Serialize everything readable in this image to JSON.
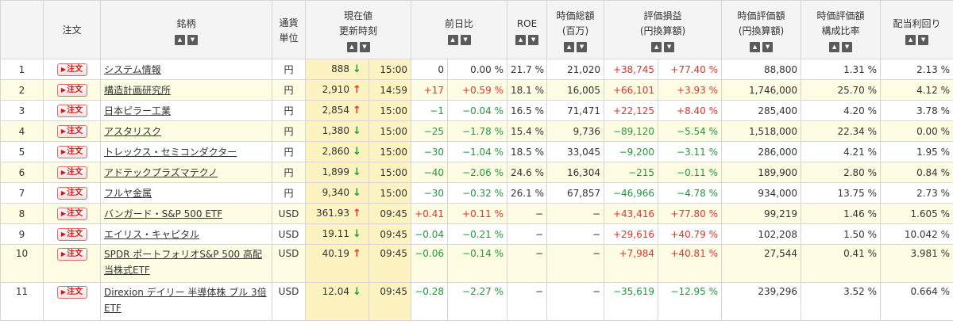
{
  "headers": {
    "no": "",
    "order": "注文",
    "name": "銘柄",
    "currency_line1": "通貨",
    "currency_line2": "単位",
    "price_line1": "現在値",
    "price_line2": "更新時刻",
    "change": "前日比",
    "roe": "ROE",
    "mcap_line1": "時価総額",
    "mcap_line2": "(百万)",
    "pl_line1": "評価損益",
    "pl_line2": "(円換算額)",
    "value_line1": "時価評価額",
    "value_line2": "(円換算額)",
    "weight_line1": "時価評価額",
    "weight_line2": "構成比率",
    "yield": "配当利回り"
  },
  "sort_icons": {
    "up": "sort-ascending-icon",
    "down": "sort-descending-icon",
    "up_glyph": "▲",
    "down_glyph": "▼"
  },
  "order_button": {
    "label": "注文",
    "icon": "triangle-right-icon",
    "color": "#d11111"
  },
  "colors": {
    "up": "#e8312f",
    "down": "#1e9b3a",
    "price_bg": "#fcf3c0",
    "alt_row": "#fffce4"
  },
  "rows": [
    {
      "no": "1",
      "name": "システム情報",
      "currency": "円",
      "price": "888",
      "dir": "down",
      "time": "15:00",
      "chg": "0",
      "chg_pct": "0.00 %",
      "chg_sign": "zero",
      "roe": "21.7 %",
      "mcap": "21,020",
      "pl": "+38,745",
      "pl_pct": "+77.40 %",
      "pl_sign": "pos",
      "value": "88,800",
      "weight": "1.31 %",
      "yield": "2.13 %"
    },
    {
      "no": "2",
      "name": "構造計画研究所",
      "currency": "円",
      "price": "2,910",
      "dir": "up",
      "time": "14:59",
      "chg": "+17",
      "chg_pct": "+0.59 %",
      "chg_sign": "pos",
      "roe": "18.1 %",
      "mcap": "16,005",
      "pl": "+66,101",
      "pl_pct": "+3.93 %",
      "pl_sign": "pos",
      "value": "1,746,000",
      "weight": "25.70 %",
      "yield": "4.12 %"
    },
    {
      "no": "3",
      "name": "日本ピラー工業",
      "currency": "円",
      "price": "2,854",
      "dir": "up",
      "time": "15:00",
      "chg": "−1",
      "chg_pct": "−0.04 %",
      "chg_sign": "neg",
      "roe": "16.5 %",
      "mcap": "71,471",
      "pl": "+22,125",
      "pl_pct": "+8.40 %",
      "pl_sign": "pos",
      "value": "285,400",
      "weight": "4.20 %",
      "yield": "3.78 %"
    },
    {
      "no": "4",
      "name": "アスタリスク",
      "currency": "円",
      "price": "1,380",
      "dir": "down",
      "time": "15:00",
      "chg": "−25",
      "chg_pct": "−1.78 %",
      "chg_sign": "neg",
      "roe": "15.4 %",
      "mcap": "9,736",
      "pl": "−89,120",
      "pl_pct": "−5.54 %",
      "pl_sign": "neg",
      "value": "1,518,000",
      "weight": "22.34 %",
      "yield": "0.00 %"
    },
    {
      "no": "5",
      "name": "トレックス・セミコンダクター",
      "currency": "円",
      "price": "2,860",
      "dir": "down",
      "time": "15:00",
      "chg": "−30",
      "chg_pct": "−1.04 %",
      "chg_sign": "neg",
      "roe": "18.5 %",
      "mcap": "33,045",
      "pl": "−9,200",
      "pl_pct": "−3.11 %",
      "pl_sign": "neg",
      "value": "286,000",
      "weight": "4.21 %",
      "yield": "1.95 %"
    },
    {
      "no": "6",
      "name": "アドテックプラズマテクノ",
      "currency": "円",
      "price": "1,899",
      "dir": "down",
      "time": "15:00",
      "chg": "−40",
      "chg_pct": "−2.06 %",
      "chg_sign": "neg",
      "roe": "24.6 %",
      "mcap": "16,304",
      "pl": "−215",
      "pl_pct": "−0.11 %",
      "pl_sign": "neg",
      "value": "189,900",
      "weight": "2.80 %",
      "yield": "0.84 %"
    },
    {
      "no": "7",
      "name": "フルヤ金属",
      "currency": "円",
      "price": "9,340",
      "dir": "down",
      "time": "15:00",
      "chg": "−30",
      "chg_pct": "−0.32 %",
      "chg_sign": "neg",
      "roe": "26.1 %",
      "mcap": "67,857",
      "pl": "−46,966",
      "pl_pct": "−4.78 %",
      "pl_sign": "neg",
      "value": "934,000",
      "weight": "13.75 %",
      "yield": "2.73 %"
    },
    {
      "no": "8",
      "name": "バンガード・S&P 500 ETF",
      "currency": "USD",
      "price": "361.93",
      "dir": "up",
      "time": "09:45",
      "chg": "+0.41",
      "chg_pct": "+0.11 %",
      "chg_sign": "pos",
      "roe": "−",
      "mcap": "−",
      "pl": "+43,416",
      "pl_pct": "+77.80 %",
      "pl_sign": "pos",
      "value": "99,219",
      "weight": "1.46 %",
      "yield": "1.605 %"
    },
    {
      "no": "9",
      "name": "エイリス・キャピタル",
      "currency": "USD",
      "price": "19.11",
      "dir": "down",
      "time": "09:45",
      "chg": "−0.04",
      "chg_pct": "−0.21 %",
      "chg_sign": "neg",
      "roe": "−",
      "mcap": "−",
      "pl": "+29,616",
      "pl_pct": "+40.79 %",
      "pl_sign": "pos",
      "value": "102,208",
      "weight": "1.50 %",
      "yield": "10.042 %"
    },
    {
      "no": "10",
      "name": "SPDR ポートフォリオS&P 500 高配当株式ETF",
      "currency": "USD",
      "price": "40.19",
      "dir": "up",
      "time": "09:45",
      "chg": "−0.06",
      "chg_pct": "−0.14 %",
      "chg_sign": "neg",
      "roe": "−",
      "mcap": "−",
      "pl": "+7,984",
      "pl_pct": "+40.81 %",
      "pl_sign": "pos",
      "value": "27,544",
      "weight": "0.41 %",
      "yield": "3.981 %"
    },
    {
      "no": "11",
      "name": "Direxion デイリー 半導体株 ブル 3倍 ETF",
      "currency": "USD",
      "price": "12.04",
      "dir": "down",
      "time": "09:45",
      "chg": "−0.28",
      "chg_pct": "−2.27 %",
      "chg_sign": "neg",
      "roe": "−",
      "mcap": "−",
      "pl": "−35,619",
      "pl_pct": "−12.95 %",
      "pl_sign": "neg",
      "value": "239,296",
      "weight": "3.52 %",
      "yield": "0.664 %"
    }
  ]
}
